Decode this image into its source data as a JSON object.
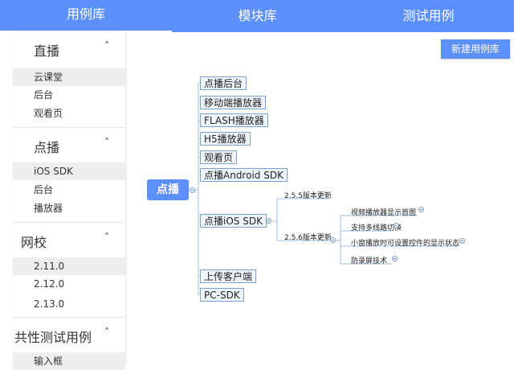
{
  "topnav": {
    "tabs": [
      "用例库",
      "模块库",
      "测试用例"
    ]
  },
  "sidebar": {
    "groups": [
      {
        "title": "直播",
        "caret": "˄",
        "items": [
          "云课堂",
          "后台",
          "观看页"
        ]
      },
      {
        "title": "点播",
        "caret": "˄",
        "items": [
          "iOS SDK",
          "后台",
          "播放器"
        ]
      },
      {
        "title": "网校",
        "caret": "˄",
        "items": [
          "2.11.0",
          "2.12.0",
          "2.13.0"
        ]
      },
      {
        "title": "共性测试用例",
        "caret": "˄",
        "items": [
          "输入框"
        ]
      }
    ]
  },
  "main": {
    "new_case_button": "新建用例库",
    "mindmap": {
      "root": "点播",
      "branches": [
        "点播后台",
        "移动端播放器",
        "FLASH播放器",
        "H5播放器",
        "观看页",
        "点播Android SDK",
        "点播iOS SDK",
        "上传客户端",
        "PC-SDK"
      ],
      "ios_versions": [
        "2.5.5版本更新",
        "2.5.6版本更新"
      ],
      "features": [
        "视频播放器显示首图",
        "支持多线路切换",
        "小窗播放时可设置控件的显示状态",
        "防录屏技术"
      ]
    }
  },
  "colors": {
    "accent": "#5b8ff9",
    "node_bg": "#eef4fb",
    "node_border": "#7aa3d0",
    "connector": "#9dbde0"
  }
}
